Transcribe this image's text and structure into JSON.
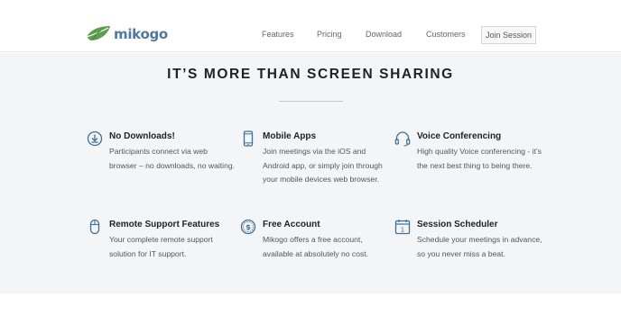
{
  "brand": {
    "name": "mikogo"
  },
  "nav": {
    "items": [
      {
        "label": "Features"
      },
      {
        "label": "Pricing"
      },
      {
        "label": "Download"
      },
      {
        "label": "Customers"
      }
    ],
    "join_label": "Join Session"
  },
  "main": {
    "heading": "IT’S MORE THAN SCREEN SHARING",
    "features": [
      {
        "icon": "download-icon",
        "title": "No Downloads!",
        "desc": "Participants connect via web browser – no downloads, no waiting."
      },
      {
        "icon": "smartphone-icon",
        "title": "Mobile Apps",
        "desc": "Join meetings via the iOS and Android app, or simply join through your mobile devices web browser."
      },
      {
        "icon": "headset-icon",
        "title": "Voice Conferencing",
        "desc": "High quality Voice conferencing - it’s the next best thing to being there."
      },
      {
        "icon": "mouse-icon",
        "title": "Remote Support Features",
        "desc": "Your complete remote support solution for IT support."
      },
      {
        "icon": "dollar-coin-icon",
        "title": "Free Account",
        "desc": "Mikogo offers a free account, available at absolutely no cost."
      },
      {
        "icon": "calendar-icon",
        "title": "Session Scheduler",
        "desc": "Schedule your meetings in advance, so you never miss a beat."
      }
    ]
  },
  "colors": {
    "accent": "#4d7a9e",
    "leaf": "#5a9e4a",
    "icon": "#3f6f93",
    "section_bg": "#f4f5f7"
  }
}
